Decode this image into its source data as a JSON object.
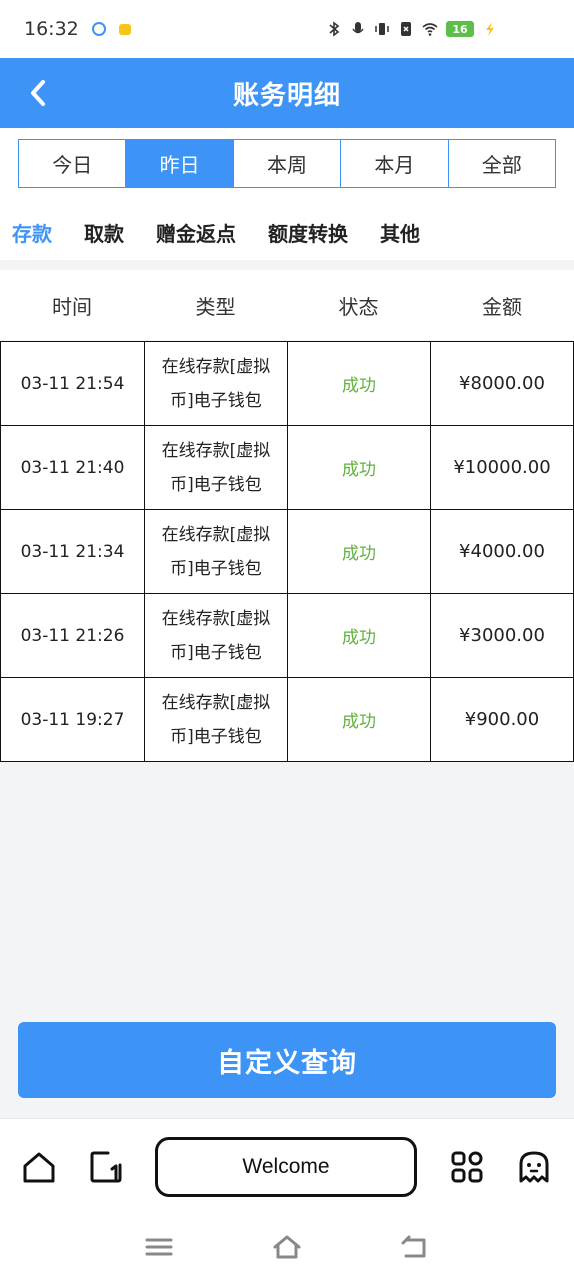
{
  "status_bar": {
    "time": "16:32",
    "battery": "16"
  },
  "header": {
    "title": "账务明细"
  },
  "date_tabs": [
    "今日",
    "昨日",
    "本周",
    "本月",
    "全部"
  ],
  "date_tab_active": "昨日",
  "type_tabs": [
    "存款",
    "取款",
    "赠金返点",
    "额度转换",
    "其他"
  ],
  "type_tab_active": "存款",
  "table": {
    "headers": [
      "时间",
      "类型",
      "状态",
      "金额"
    ],
    "rows": [
      {
        "time": "03-11 21:54",
        "type": "在线存款[虚拟币]电子钱包",
        "status": "成功",
        "amount": "¥8000.00"
      },
      {
        "time": "03-11 21:40",
        "type": "在线存款[虚拟币]电子钱包",
        "status": "成功",
        "amount": "¥10000.00"
      },
      {
        "time": "03-11 21:34",
        "type": "在线存款[虚拟币]电子钱包",
        "status": "成功",
        "amount": "¥4000.00"
      },
      {
        "time": "03-11 21:26",
        "type": "在线存款[虚拟币]电子钱包",
        "status": "成功",
        "amount": "¥3000.00"
      },
      {
        "time": "03-11 19:27",
        "type": "在线存款[虚拟币]电子钱包",
        "status": "成功",
        "amount": "¥900.00"
      }
    ]
  },
  "query_button": "自定义查询",
  "bottom_nav": {
    "welcome": "Welcome"
  },
  "colors": {
    "accent": "#3d94f6",
    "success": "#5fb33c"
  }
}
